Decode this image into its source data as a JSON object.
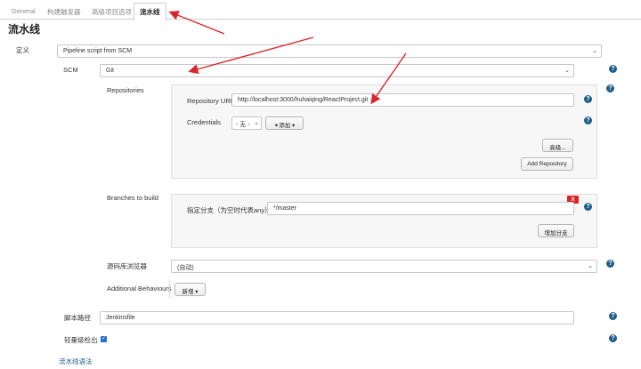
{
  "tabs": [
    {
      "label": "General"
    },
    {
      "label": "构建触发器"
    },
    {
      "label": "高级项目选项"
    },
    {
      "label": "流水线"
    }
  ],
  "section_title": "流水线",
  "definition": {
    "label": "定义",
    "value": "Pipeline script from SCM"
  },
  "scm": {
    "label": "SCM",
    "value": "Git"
  },
  "repositories": {
    "label": "Repositories",
    "url_label": "Repository URL",
    "url_value": "http://localhost:3000/huhaiqing/ReactProject.git",
    "credentials_label": "Credentials",
    "credentials_value": "- 无 -",
    "add_label": "添加",
    "advanced_button": "高级...",
    "add_repository_button": "Add Repository"
  },
  "branches": {
    "label": "Branches to build",
    "delete_label": "X",
    "branch_label": "指定分支（为空时代表any）",
    "branch_value": "*/master",
    "add_branch_button": "增加分支"
  },
  "browser": {
    "label": "源码库浏览器",
    "value": "(自动)"
  },
  "additional": {
    "label": "Additional Behaviours",
    "add_button": "新增"
  },
  "script_path": {
    "label": "脚本路径",
    "value": "Jenkinsfile"
  },
  "lightweight": {
    "label": "轻量级检出"
  },
  "pipeline_syntax_link": "流水线语法",
  "colors": {
    "accent": "#1f5f8b",
    "arrow": "#d9262b",
    "danger": "#dd2222"
  }
}
